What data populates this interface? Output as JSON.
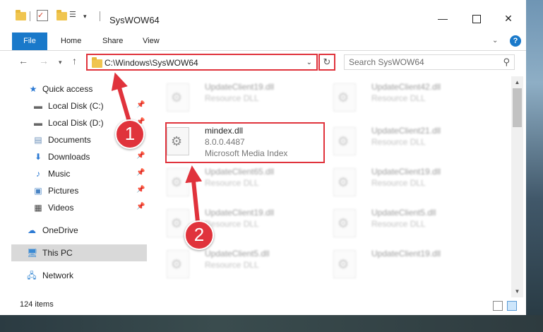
{
  "window": {
    "title": "SysWOW64",
    "minimize": "—",
    "close": "✕"
  },
  "ribbon": {
    "tabs": [
      "File",
      "Home",
      "Share",
      "View"
    ]
  },
  "navigation": {
    "address": "C:\\Windows\\SysWOW64",
    "search_placeholder": "Search SysWOW64"
  },
  "sidebar": {
    "items": [
      {
        "label": "Quick access",
        "icon": "star-icon",
        "pinned": false
      },
      {
        "label": "Local Disk (C:)",
        "icon": "drive-icon",
        "pinned": true
      },
      {
        "label": "Local Disk (D:)",
        "icon": "drive-icon",
        "pinned": true
      },
      {
        "label": "Documents",
        "icon": "documents-icon",
        "pinned": true
      },
      {
        "label": "Downloads",
        "icon": "download-icon",
        "pinned": true
      },
      {
        "label": "Music",
        "icon": "music-icon",
        "pinned": true
      },
      {
        "label": "Pictures",
        "icon": "pictures-icon",
        "pinned": true
      },
      {
        "label": "Videos",
        "icon": "videos-icon",
        "pinned": true
      },
      {
        "label": "OneDrive",
        "icon": "cloud-icon",
        "pinned": false
      },
      {
        "label": "This PC",
        "icon": "computer-icon",
        "pinned": false,
        "selected": true
      },
      {
        "label": "Network",
        "icon": "network-icon",
        "pinned": false
      }
    ]
  },
  "files": {
    "highlighted": {
      "name": "mindex.dll",
      "version": "8.0.0.4487",
      "description": "Microsoft Media Index"
    },
    "items": [
      {
        "name": "UpdateClient19.dll",
        "type": "Resource DLL"
      },
      {
        "name": "UpdateClient42.dll",
        "type": "Resource DLL"
      },
      {
        "name": "UpdateClient21.dll",
        "type": "Resource DLL"
      },
      {
        "name": "UpdateClient65.dll",
        "type": "Resource DLL"
      },
      {
        "name": "UpdateClient19.dll",
        "type": "Resource DLL"
      },
      {
        "name": "UpdateClient19.dll",
        "type": "Resource DLL"
      },
      {
        "name": "UpdateClient5.dll",
        "type": "Resource DLL"
      },
      {
        "name": "UpdateClient5.dll",
        "type": "Resource DLL"
      },
      {
        "name": "UpdateClient19.dll",
        "type": "Resource DLL"
      }
    ]
  },
  "status": {
    "item_count": "124 items"
  },
  "annotations": {
    "badge_1": "1",
    "badge_2": "2",
    "color": "#e0333c"
  }
}
